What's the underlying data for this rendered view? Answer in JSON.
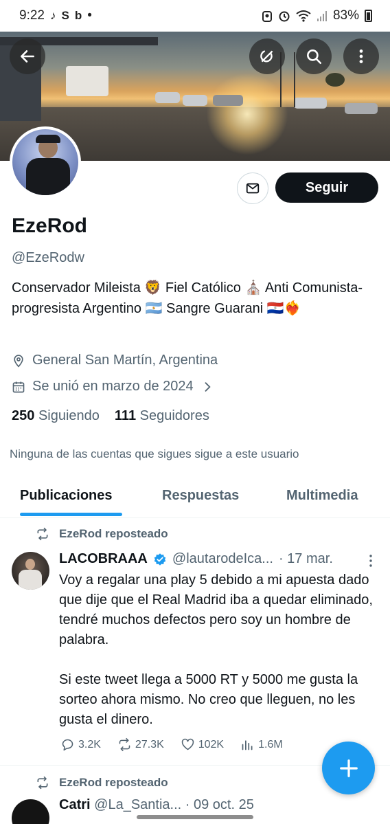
{
  "status_bar": {
    "time": "9:22",
    "notification_icons": [
      "tiktok-icon",
      "s-icon",
      "b-icon"
    ],
    "dot": "•",
    "battery": "83%",
    "status_icons": [
      "profile-icon",
      "alarm-icon",
      "wifi-icon",
      "signal-icon",
      "battery-icon"
    ]
  },
  "header": {
    "back_icon": "arrow-left-icon",
    "grok_icon": "grok-icon",
    "search_icon": "search-icon",
    "more_icon": "more-vertical-icon"
  },
  "profile": {
    "name": "EzeRod",
    "handle": "@EzeRodw",
    "bio": "Conservador Mileista 🦁 Fiel Católico ⛪ Anti Comunista-progresista Argentino 🇦🇷 Sangre Guarani 🇵🇾❤️‍🔥",
    "location": "General San Martín, Argentina",
    "joined": "Se unió en marzo de 2024",
    "following_count": "250",
    "following_label": "Siguiendo",
    "followers_count": "111",
    "followers_label": "Seguidores",
    "mutuals_note": "Ninguna de las cuentas que sigues sigue a este usuario",
    "follow_label": "Seguir"
  },
  "tabs": [
    {
      "label": "Publicaciones",
      "active": true
    },
    {
      "label": "Respuestas",
      "active": false
    },
    {
      "label": "Multimedia",
      "active": false
    }
  ],
  "tweets": [
    {
      "repost_label": "EzeRod reposteado",
      "author": "LACOBRAAA",
      "handle": "@lautarodeIca...",
      "date": "· 17 mar.",
      "text": "Voy a regalar una play 5 debido a mi apuesta dado que dije que el Real Madrid iba a quedar eliminado, tendré muchos defectos pero soy un hombre de palabra.\n\nSi este tweet llega a 5000 RT y 5000 me gusta la sorteo ahora mismo. No creo que lleguen, no les gusta el dinero.",
      "replies": "3.2K",
      "reposts": "27.3K",
      "likes": "102K",
      "views": "1.6M"
    },
    {
      "repost_label": "EzeRod reposteado",
      "author": "Catri",
      "handle": "@La_Santia...",
      "date": "· 09 oct. 25"
    }
  ],
  "colors": {
    "accent": "#1d9bf0",
    "text": "#0f1419",
    "secondary": "#536471"
  }
}
